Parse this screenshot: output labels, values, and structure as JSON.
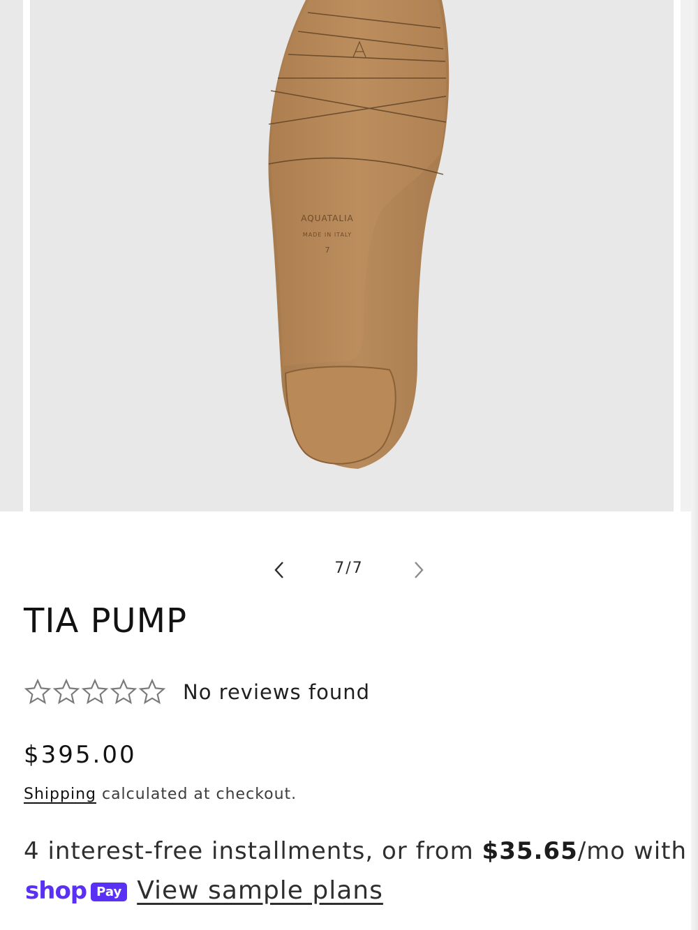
{
  "gallery": {
    "image_text": {
      "brand": "AQUATALIA",
      "origin": "MADE IN ITALY",
      "size": "7"
    },
    "counter": "7/7",
    "prev_icon": "chevron-left-icon",
    "next_icon": "chevron-right-icon"
  },
  "product": {
    "title": "TIA PUMP",
    "reviews_text": "No reviews found",
    "star_rating": 0,
    "price": "$395.00",
    "shipping_link": "Shipping",
    "shipping_text": " calculated at checkout."
  },
  "installments": {
    "prefix": "4 interest-free installments, or from ",
    "amount": "$35.65",
    "suffix": "/mo with",
    "shop_word": "shop",
    "pay_badge": "Pay",
    "link": "View sample plans"
  },
  "colors": {
    "shop_pay_purple": "#5a31f4",
    "image_background": "#e8e8e8",
    "sole_tan": "#b98a58"
  }
}
